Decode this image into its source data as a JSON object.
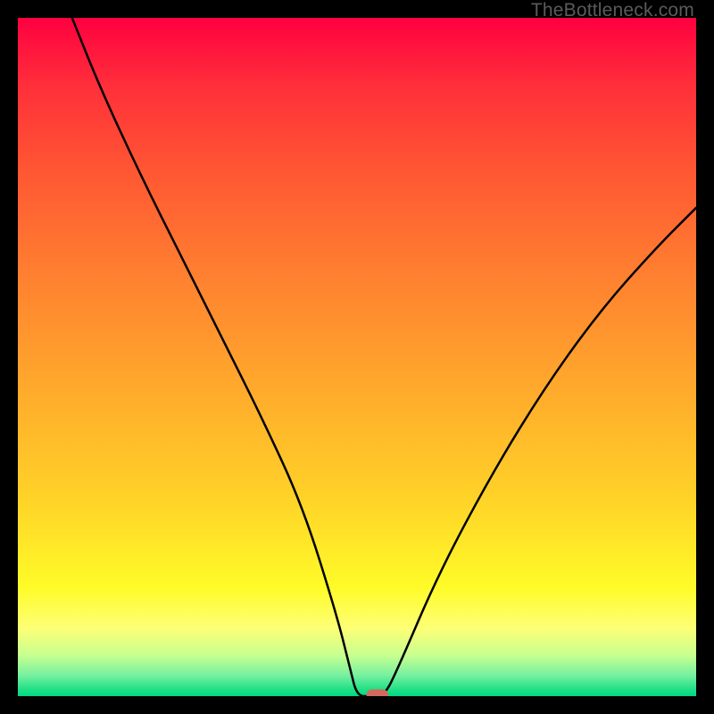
{
  "watermark": "TheBottleneck.com",
  "chart_data": {
    "type": "line",
    "title": "",
    "xlabel": "",
    "ylabel": "",
    "x_range": [
      0,
      100
    ],
    "y_range": [
      0,
      100
    ],
    "series": [
      {
        "name": "curve",
        "x": [
          8,
          12,
          18,
          24,
          30,
          36,
          42,
          47,
          49,
          50,
          52,
          54,
          56,
          62,
          70,
          78,
          86,
          94,
          100
        ],
        "y": [
          100,
          90,
          77,
          65,
          53,
          41,
          28,
          12,
          4,
          0,
          0,
          0,
          4,
          18,
          33,
          46,
          57,
          66,
          72
        ]
      }
    ],
    "marker": {
      "x": 53,
      "y": 0,
      "w": 3.2,
      "h": 2.0
    },
    "colors": {
      "curve": "#000000",
      "marker": "#d46a5e"
    }
  }
}
